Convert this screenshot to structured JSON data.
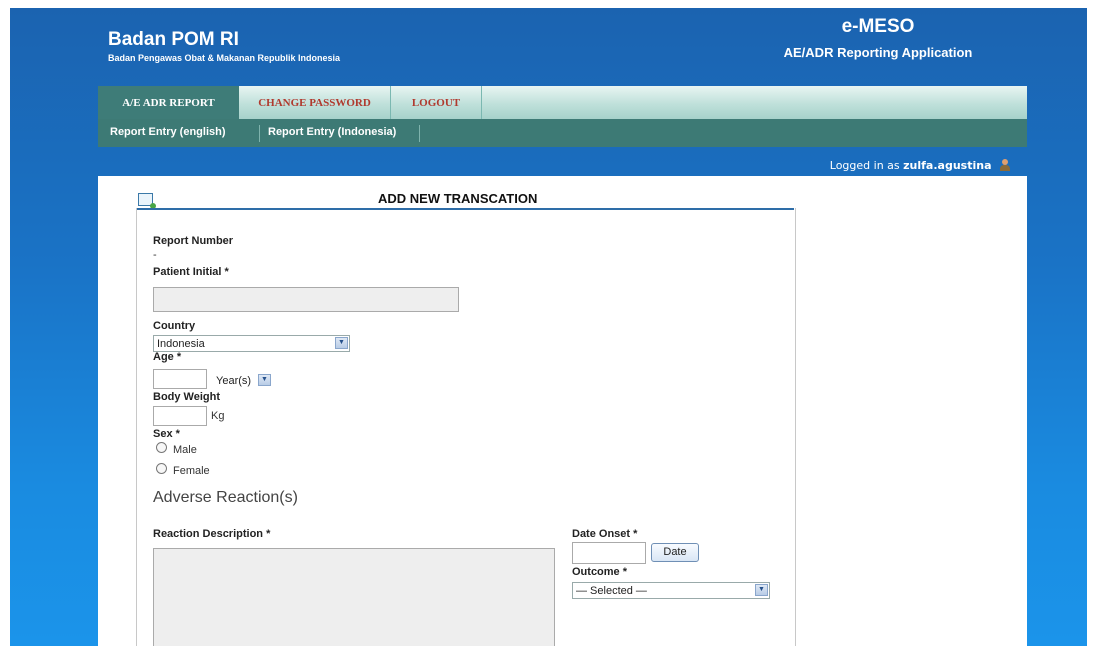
{
  "header": {
    "org_name": "Badan POM RI",
    "org_full": "Badan Pengawas Obat & Makanan Republik Indonesia",
    "app_name": "e-MESO",
    "app_subtitle": "AE/ADR Reporting Application"
  },
  "nav": {
    "tabs": [
      {
        "label": "A/E ADR REPORT",
        "active": true
      },
      {
        "label": "CHANGE PASSWORD",
        "active": false
      },
      {
        "label": "LOGOUT",
        "active": false
      }
    ],
    "sub_links": [
      {
        "label": "Report Entry (english)"
      },
      {
        "label": "Report Entry (Indonesia)"
      }
    ]
  },
  "login": {
    "prefix": "Logged in as",
    "username": "zulfa.agustina"
  },
  "form": {
    "title": "ADD NEW TRANSCATION",
    "report_number_label": "Report Number",
    "report_number_value": "-",
    "patient_initial_label": "Patient Initial *",
    "patient_initial_value": "",
    "country_label": "Country",
    "country_value": "Indonesia",
    "age_label": "Age *",
    "age_value": "",
    "age_unit": "Year(s)",
    "body_weight_label": "Body Weight",
    "body_weight_value": "",
    "body_weight_unit": "Kg",
    "sex_label": "Sex *",
    "sex_options": [
      "Male",
      "Female"
    ],
    "adverse_section": "Adverse Reaction(s)",
    "reaction_description_label": "Reaction Description *",
    "date_onset_label": "Date Onset *",
    "date_button": "Date",
    "outcome_label": "Outcome *",
    "outcome_value": "— Selected —"
  }
}
